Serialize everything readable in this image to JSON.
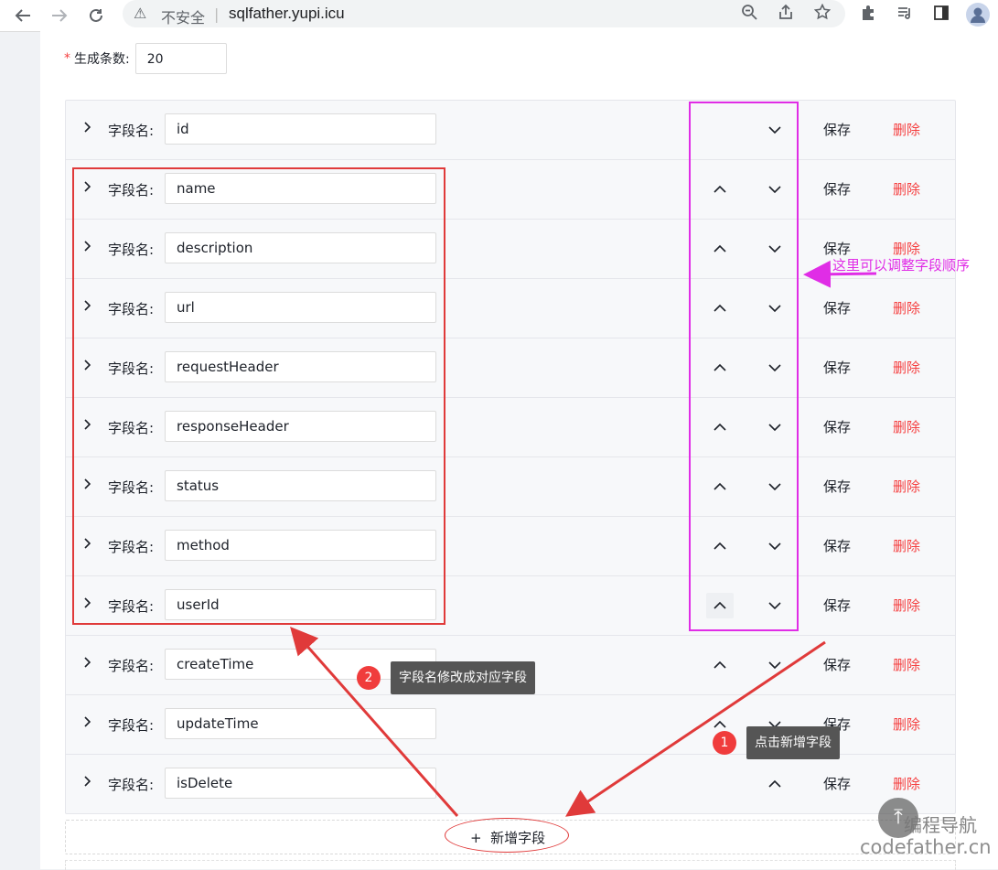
{
  "browser": {
    "security_text": "不安全",
    "separator": "|",
    "url": "sqlfather.yupi.icu"
  },
  "form": {
    "count_label": "生成条数:",
    "count_required": "*",
    "count_value": "20"
  },
  "field_label": "字段名:",
  "fields": [
    {
      "name": "id",
      "has_up": false,
      "has_down": true,
      "save": "保存",
      "delete": "删除"
    },
    {
      "name": "name",
      "has_up": true,
      "has_down": true,
      "save": "保存",
      "delete": "删除"
    },
    {
      "name": "description",
      "has_up": true,
      "has_down": true,
      "save": "保存",
      "delete": "删除"
    },
    {
      "name": "url",
      "has_up": true,
      "has_down": true,
      "save": "保存",
      "delete": "删除"
    },
    {
      "name": "requestHeader",
      "has_up": true,
      "has_down": true,
      "save": "保存",
      "delete": "删除"
    },
    {
      "name": "responseHeader",
      "has_up": true,
      "has_down": true,
      "save": "保存",
      "delete": "删除"
    },
    {
      "name": "status",
      "has_up": true,
      "has_down": true,
      "save": "保存",
      "delete": "删除"
    },
    {
      "name": "method",
      "has_up": true,
      "has_down": true,
      "save": "保存",
      "delete": "删除"
    },
    {
      "name": "userId",
      "has_up": true,
      "has_down": true,
      "save": "保存",
      "delete": "删除"
    },
    {
      "name": "createTime",
      "has_up": true,
      "has_down": true,
      "save": "保存",
      "delete": "删除"
    },
    {
      "name": "updateTime",
      "has_up": true,
      "has_down": true,
      "save": "保存",
      "delete": "删除"
    },
    {
      "name": "isDelete",
      "has_up": true,
      "has_down": false,
      "save": "保存",
      "delete": "删除"
    }
  ],
  "add_field": {
    "icon": "+",
    "label": "新增字段"
  },
  "annotations": {
    "reorder_note": "这里可以调整字段顺序",
    "step1_number": "1",
    "step1_text": "点击新增字段",
    "step2_number": "2",
    "step2_text": "字段名修改成对应字段",
    "red_color": "#e03a3a",
    "magenta_color": "#e02de6"
  },
  "watermark": {
    "line1": "编程导航",
    "line2": "codefather.cn"
  }
}
